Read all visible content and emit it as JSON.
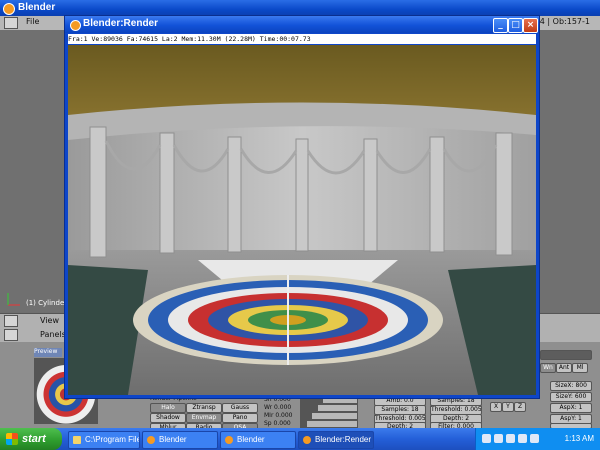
{
  "blender": {
    "window_title": "Blender",
    "menu_label": "File",
    "stats_text": "1474 | Ob:157-1",
    "object_label": "(1) Cylinder.3",
    "view_label": "View",
    "panels_label": "Panels",
    "preview_tab": "Preview"
  },
  "render_window": {
    "title": "Blender:Render",
    "status": "Fra:1  Ve:89036 Fa:74615 La:2 Mem:11.30M (22.28M) Time:00:07.73"
  },
  "buttons_panel": {
    "render_pipeline_label": "Render Pipeline",
    "buttons": [
      "Halo",
      "Ztransp",
      "Gauss",
      "Shadow",
      "Envmap",
      "Pano",
      "Mblur",
      "Radio",
      "OSA",
      "Fields",
      "Odd",
      "X",
      "Border",
      "Gamma"
    ],
    "sliders": [
      "Sh 0.000",
      "Wr 0.000",
      "MIr 0.000",
      "Sp 0.000"
    ],
    "samples_a": [
      "Samples: 18",
      "Threshold: 0.005",
      "Depth: 2"
    ],
    "samples_b": [
      "Samples: 18",
      "Threshold: 0.005",
      "Depth: 2",
      "Filter: 0.000"
    ],
    "amb_label": "Amb: 0.0",
    "quality_tabs": [
      "Wn",
      "Ant",
      "Ml"
    ],
    "dimension_values": [
      "SizeX: 800",
      "SizeY: 600",
      "AspX: 1",
      "AspY: 1",
      "Frs: 1"
    ],
    "option_labels": [
      "Hsp",
      "Sel",
      "Key",
      "Max"
    ],
    "xyz_labels": [
      "X",
      "Y",
      "Z"
    ]
  },
  "taskbar": {
    "start_label": "start",
    "tasks": [
      "C:\\Program File...",
      "Blender",
      "Blender",
      "Blender:Render"
    ],
    "clock": "1:13 AM"
  }
}
